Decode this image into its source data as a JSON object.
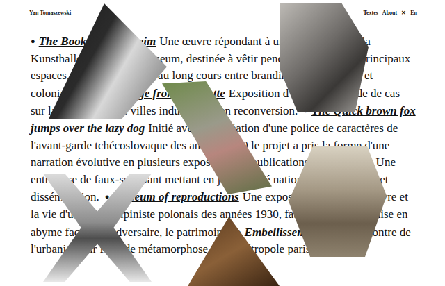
{
  "header": {
    "name": "Yan Tomaszewski",
    "nav": [
      "Textes",
      "About",
      "✕",
      "En"
    ]
  },
  "entries": [
    {
      "bullet": "●",
      "title": "The Book of Mannheim",
      "text": "Une œuvre répondant à une commande de la Kunsthalle Mannheim Museum, destinée à vêtir pendant six mois les principaux espaces. Une performance au long cours entre branding, cannibalisme et colonialisme."
    },
    {
      "bullet": "●",
      "title": "Message from Charlotte",
      "text": "Exposition d'ancrage et étude de cas sur la promotion des villes industrielles en reconversion."
    },
    {
      "bullet": "●",
      "title": "The Quick brown fox jumps over the lazy dog",
      "text": "Initié avec la recréation d'une police de caractères de l'avant-garde tchécoslovaque des années 1920 le projet a pris la forme d'une narration évolutive en plusieurs expositions et publications de référence. Une entreprise de faux-semblant mettant en jeu identité nationale, surréalisme et dissémination."
    },
    {
      "bullet": "●",
      "title": "Museum of reproductions",
      "text": "Une exposition retraçant l'œuvre et la vie d'un artiste-alpiniste polonais des années 1930, fabrique d'artistes mise en abyme face à un adversaire, le patrimoine."
    },
    {
      "bullet": "●",
      "title": "Embellissements",
      "text": "Une rencontre de l'urbaniste sur fond de métamorphose de la métropole parisienne."
    }
  ]
}
